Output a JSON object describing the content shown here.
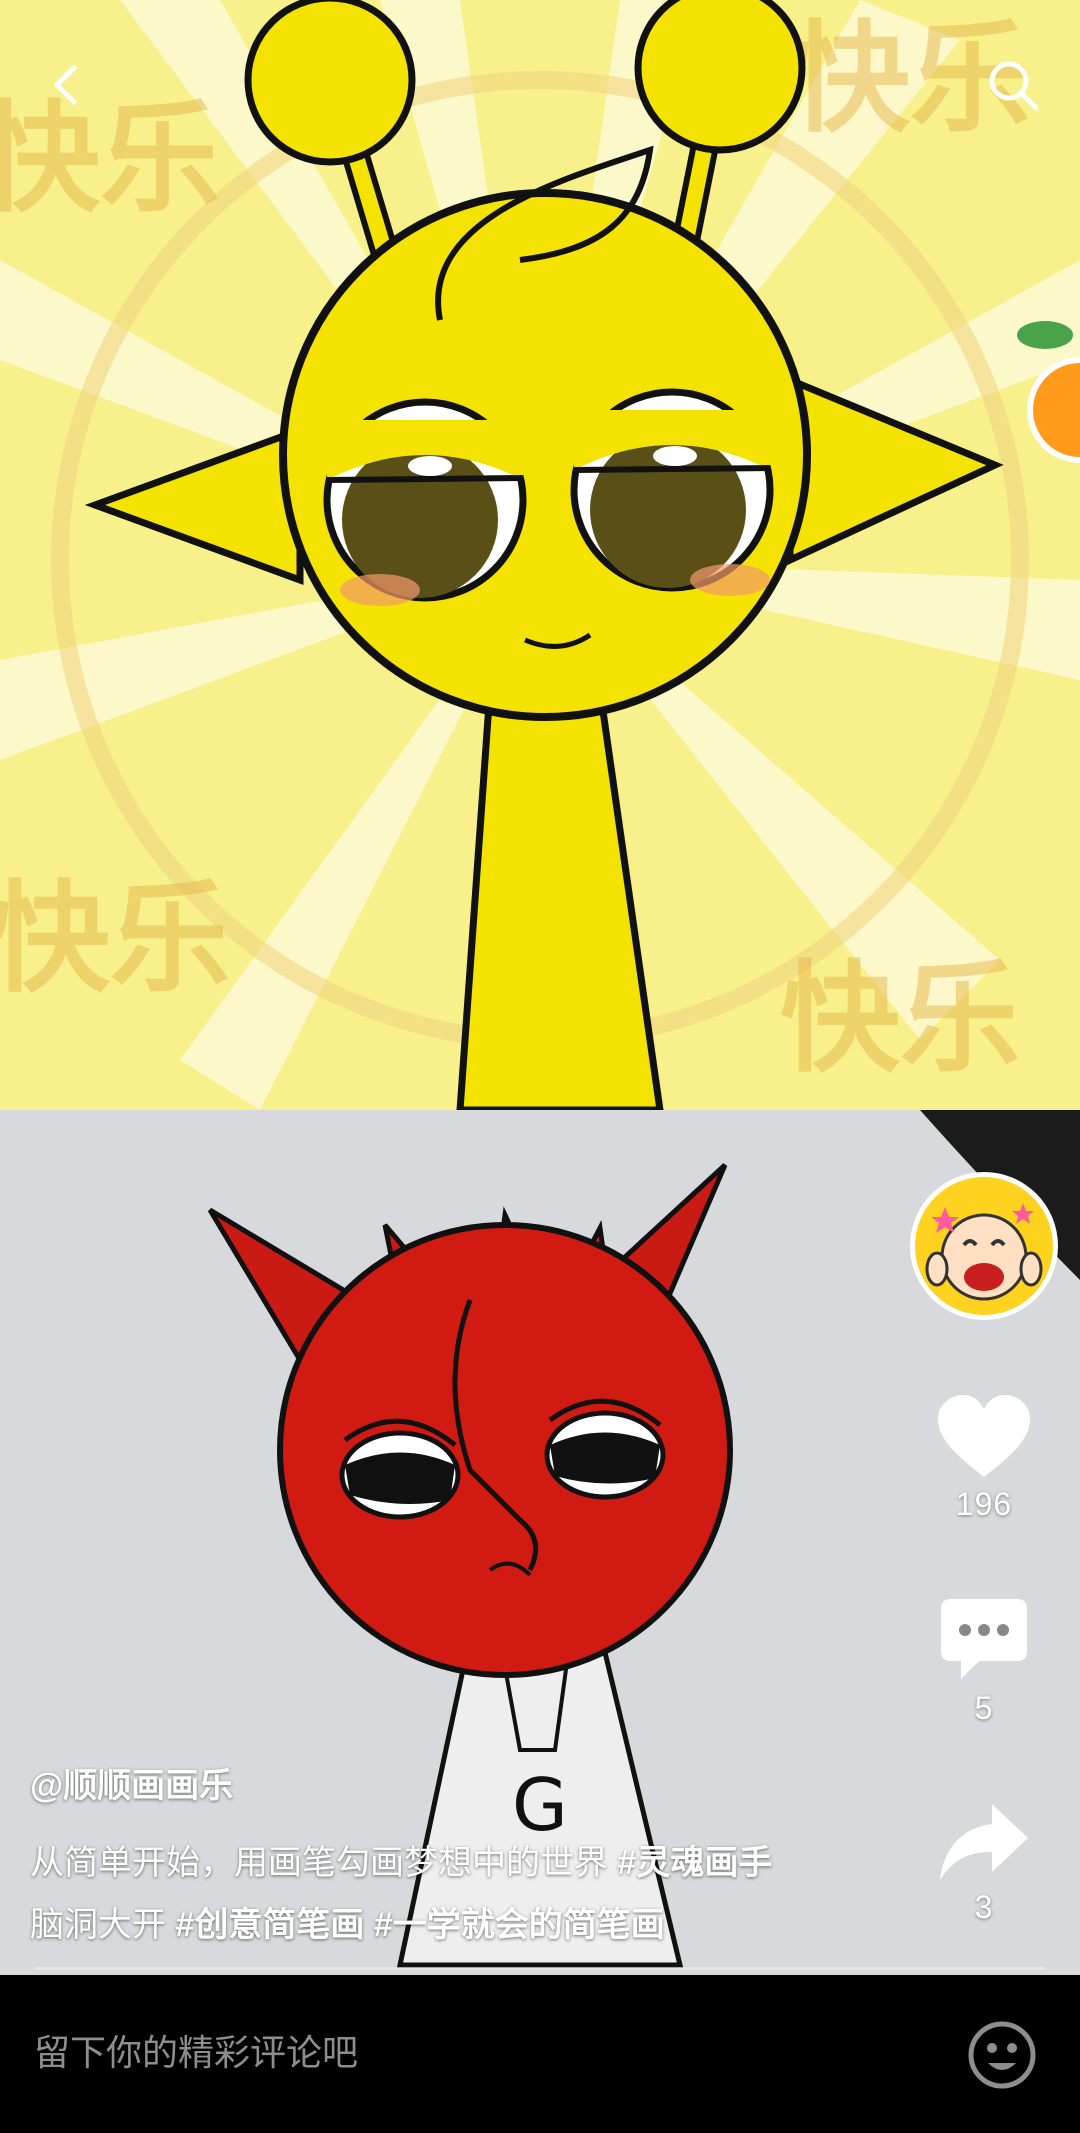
{
  "video": {
    "author": "@顺顺画画乐",
    "caption_line1": "从简单开始，用画笔勾画梦想中的世界 ",
    "tag1": "#灵魂画手",
    "caption_line2": "脑洞大开 ",
    "tag2": "#创意简笔画",
    "tag3": " #一学就会的简笔画"
  },
  "actions": {
    "likes": "196",
    "comments": "5",
    "shares": "3"
  },
  "comment_bar": {
    "placeholder": "留下你的精彩评论吧"
  },
  "colors": {
    "background_yellow": "#f8f08a",
    "character_yellow": "#f4e200",
    "drawing_red": "#d11a12",
    "paper_gray": "#d7d9dc"
  }
}
